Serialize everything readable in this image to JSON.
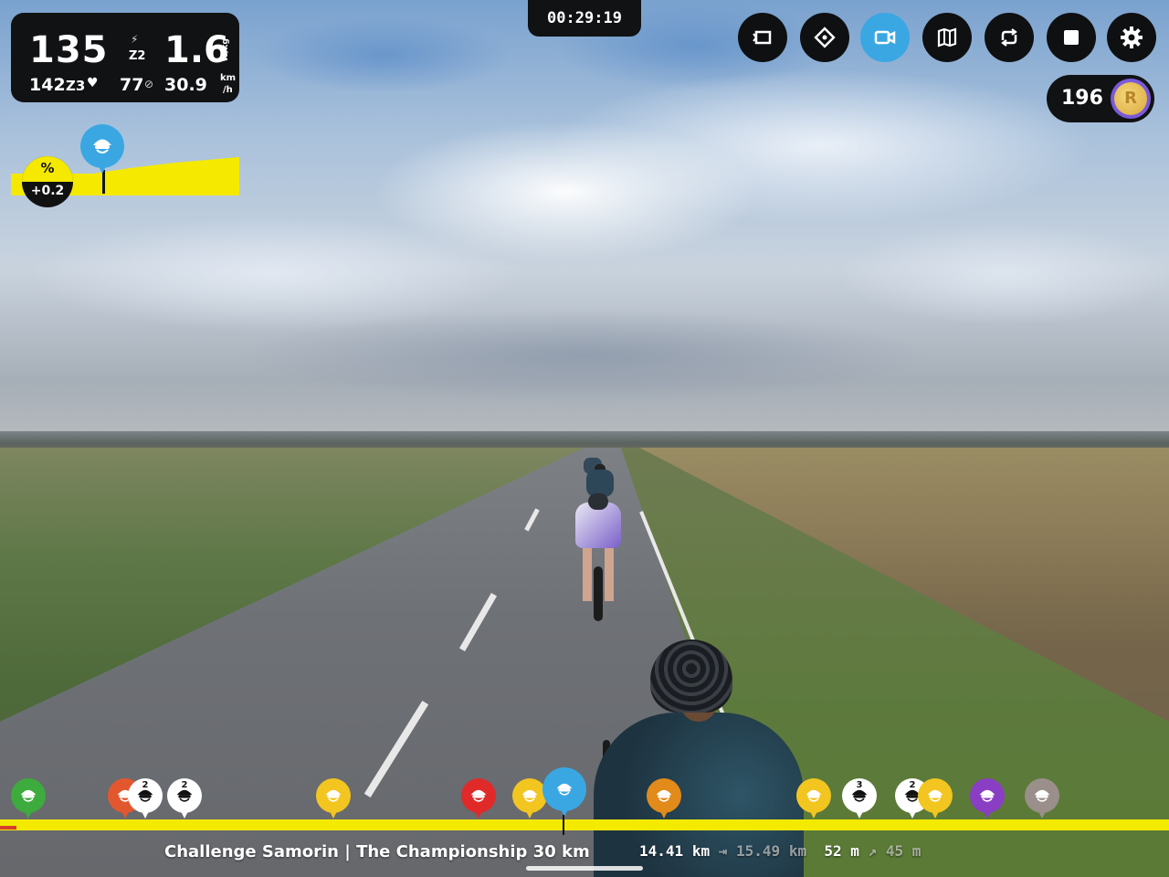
{
  "hud": {
    "power": "135",
    "power_zone": "Z2",
    "wkg": "1.6",
    "wkg_unit": "W/kg",
    "heart_rate": "142",
    "hr_zone": "Z3",
    "cadence": "77",
    "speed": "30.9",
    "speed_unit_top": "km",
    "speed_unit_bottom": "/h"
  },
  "grade": {
    "symbol": "%",
    "value": "+0.2"
  },
  "timer": "00:29:19",
  "toolbar": {
    "buttons": [
      {
        "icon": "exit-fullscreen-icon",
        "active": false
      },
      {
        "icon": "route-icon",
        "active": false
      },
      {
        "icon": "camera-icon",
        "active": true
      },
      {
        "icon": "map-icon",
        "active": false
      },
      {
        "icon": "loop-icon",
        "active": false
      },
      {
        "icon": "stop-icon",
        "active": false
      },
      {
        "icon": "settings-icon",
        "active": false
      }
    ],
    "active_color": "#3aa7e3"
  },
  "coins": {
    "count": "196",
    "coin_letter": "R"
  },
  "route": {
    "name": "Challenge Samorin | The Championship 30 km",
    "distance_done": "14.41",
    "distance_done_unit": "km",
    "distance_total": "15.49",
    "distance_total_unit": "km",
    "elevation_done": "52",
    "elevation_done_unit": "m",
    "elevation_total": "45",
    "elevation_total_unit": "m"
  },
  "riders_on_bar": [
    {
      "color": "#3dab3d",
      "label": ""
    },
    {
      "color": "#e2572e",
      "label": ""
    },
    {
      "color": "#ffffff",
      "label": "2"
    },
    {
      "color": "#ffffff",
      "label": "2"
    },
    {
      "color": "#f3c520",
      "label": ""
    },
    {
      "color": "#e02a2a",
      "label": ""
    },
    {
      "color": "#f3c520",
      "label": ""
    },
    {
      "color": "#3aa7e3",
      "label": ""
    },
    {
      "color": "#e28a1a",
      "label": ""
    },
    {
      "color": "#f3c520",
      "label": ""
    },
    {
      "color": "#ffffff",
      "label": "3"
    },
    {
      "color": "#ffffff",
      "label": "2"
    },
    {
      "color": "#f3c520",
      "label": ""
    },
    {
      "color": "#8a3ec4",
      "label": ""
    },
    {
      "color": "#9a8f8a",
      "label": ""
    }
  ],
  "colors": {
    "yellow": "#f5e900",
    "panel": "#111214"
  }
}
